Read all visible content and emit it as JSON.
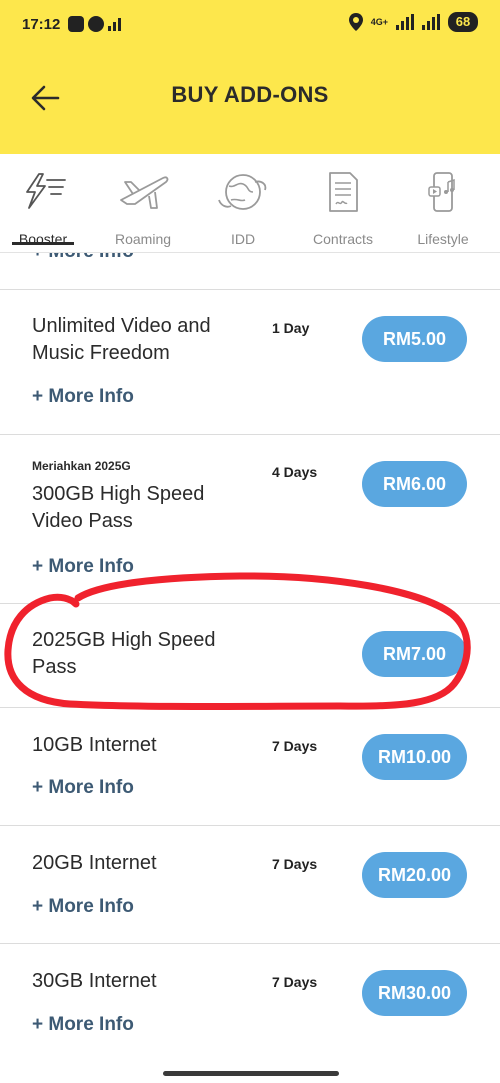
{
  "status_bar": {
    "time": "17:12",
    "network": "4G+",
    "battery": "68"
  },
  "header": {
    "title": "BUY ADD-ONS",
    "background_color": "#fde74c"
  },
  "tabs": [
    {
      "label": "Booster",
      "icon": "lightning-filter-icon",
      "active": true
    },
    {
      "label": "Roaming",
      "icon": "airplane-icon",
      "active": false
    },
    {
      "label": "IDD",
      "icon": "globe-phone-icon",
      "active": false
    },
    {
      "label": "Contracts",
      "icon": "document-icon",
      "active": false
    },
    {
      "label": "Lifestyle",
      "icon": "phone-media-icon",
      "active": false
    }
  ],
  "list": {
    "partial_more_info": "+ More Info",
    "items": [
      {
        "tag": "",
        "title": "Unlimited Video and Music Freedom",
        "duration": "1 Day",
        "price": "RM5.00",
        "more_info": "+ More Info"
      },
      {
        "tag": "Meriahkan 2025G",
        "title": "300GB High Speed Video Pass",
        "duration": "4 Days",
        "price": "RM6.00",
        "more_info": "+ More Info"
      },
      {
        "tag": "",
        "title": "2025GB High Speed Pass",
        "duration": "",
        "price": "RM7.00",
        "more_info": "",
        "highlighted": true
      },
      {
        "tag": "",
        "title": "10GB Internet",
        "duration": "7 Days",
        "price": "RM10.00",
        "more_info": "+ More Info"
      },
      {
        "tag": "",
        "title": "20GB Internet",
        "duration": "7 Days",
        "price": "RM20.00",
        "more_info": "+ More Info"
      },
      {
        "tag": "",
        "title": "30GB Internet",
        "duration": "7 Days",
        "price": "RM30.00",
        "more_info": "+ More Info"
      }
    ]
  },
  "colors": {
    "accent_yellow": "#fde74c",
    "price_button": "#5aa7e0",
    "more_info_text": "#3d5a74",
    "annotation_red": "#f0222d"
  }
}
